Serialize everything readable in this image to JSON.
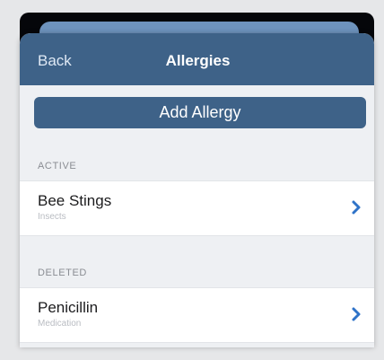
{
  "nav": {
    "back_label": "Back",
    "title": "Allergies"
  },
  "add_button_label": "Add Allergy",
  "sections": {
    "active": {
      "header": "ACTIVE",
      "items": [
        {
          "name": "Bee Stings",
          "category": "Insects"
        }
      ]
    },
    "deleted": {
      "header": "DELETED",
      "items": [
        {
          "name": "Penicillin",
          "category": "Medication"
        }
      ]
    }
  },
  "colors": {
    "nav_bar": "#3e6288",
    "accent_chevron": "#2f73c8",
    "background": "#eef0f3"
  },
  "icons": {
    "row_disclosure": "chevron-right-icon"
  }
}
